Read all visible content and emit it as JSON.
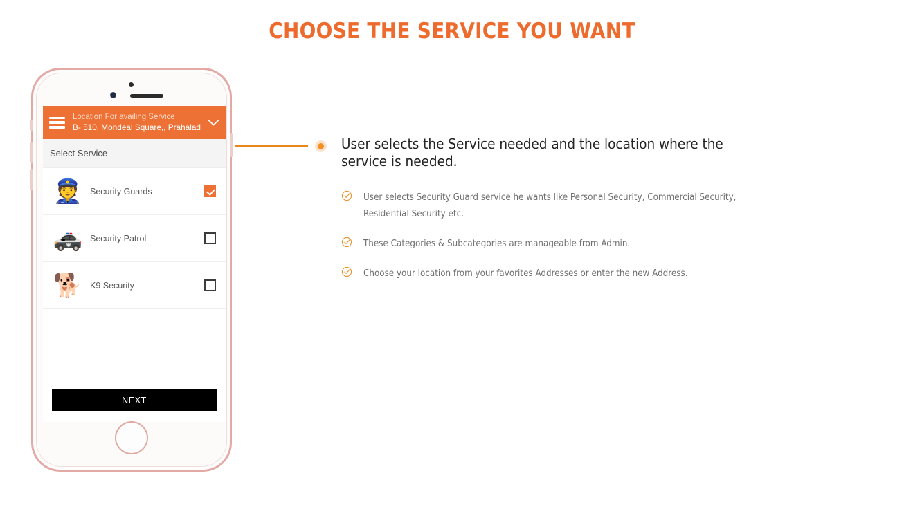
{
  "page": {
    "title": "CHOOSE THE SERVICE YOU WANT",
    "accent_color": "#ED7134",
    "title_color": "#ED6B2D",
    "connector_color": "#E8871E"
  },
  "phone": {
    "screen": {
      "header": {
        "menu_icon": "hamburger-menu-icon",
        "label": "Location For availing Service",
        "value": "B- 510, Mondeal Square,, Prahalad",
        "dropdown_icon": "chevron-down-icon"
      },
      "section_title": "Select Service",
      "services": [
        {
          "icon": "police-officer-icon",
          "glyph": "👮",
          "label": "Security Guards",
          "checked": true
        },
        {
          "icon": "police-car-icon",
          "glyph": "🚓",
          "label": "Security Patrol",
          "checked": false
        },
        {
          "icon": "person-walking-dog-icon",
          "glyph": "🐕",
          "label": "K9 Security",
          "checked": false
        }
      ],
      "next_button": "NEXT"
    }
  },
  "content": {
    "heading": "User selects the Service needed and the location where the service is needed.",
    "bullets": [
      "User selects Security Guard service he wants like Personal Security, Commercial Security, Residential Security etc.",
      "These Categories & Subcategories are manageable from Admin.",
      "Choose your location from your favorites Addresses or enter the new Address."
    ]
  }
}
